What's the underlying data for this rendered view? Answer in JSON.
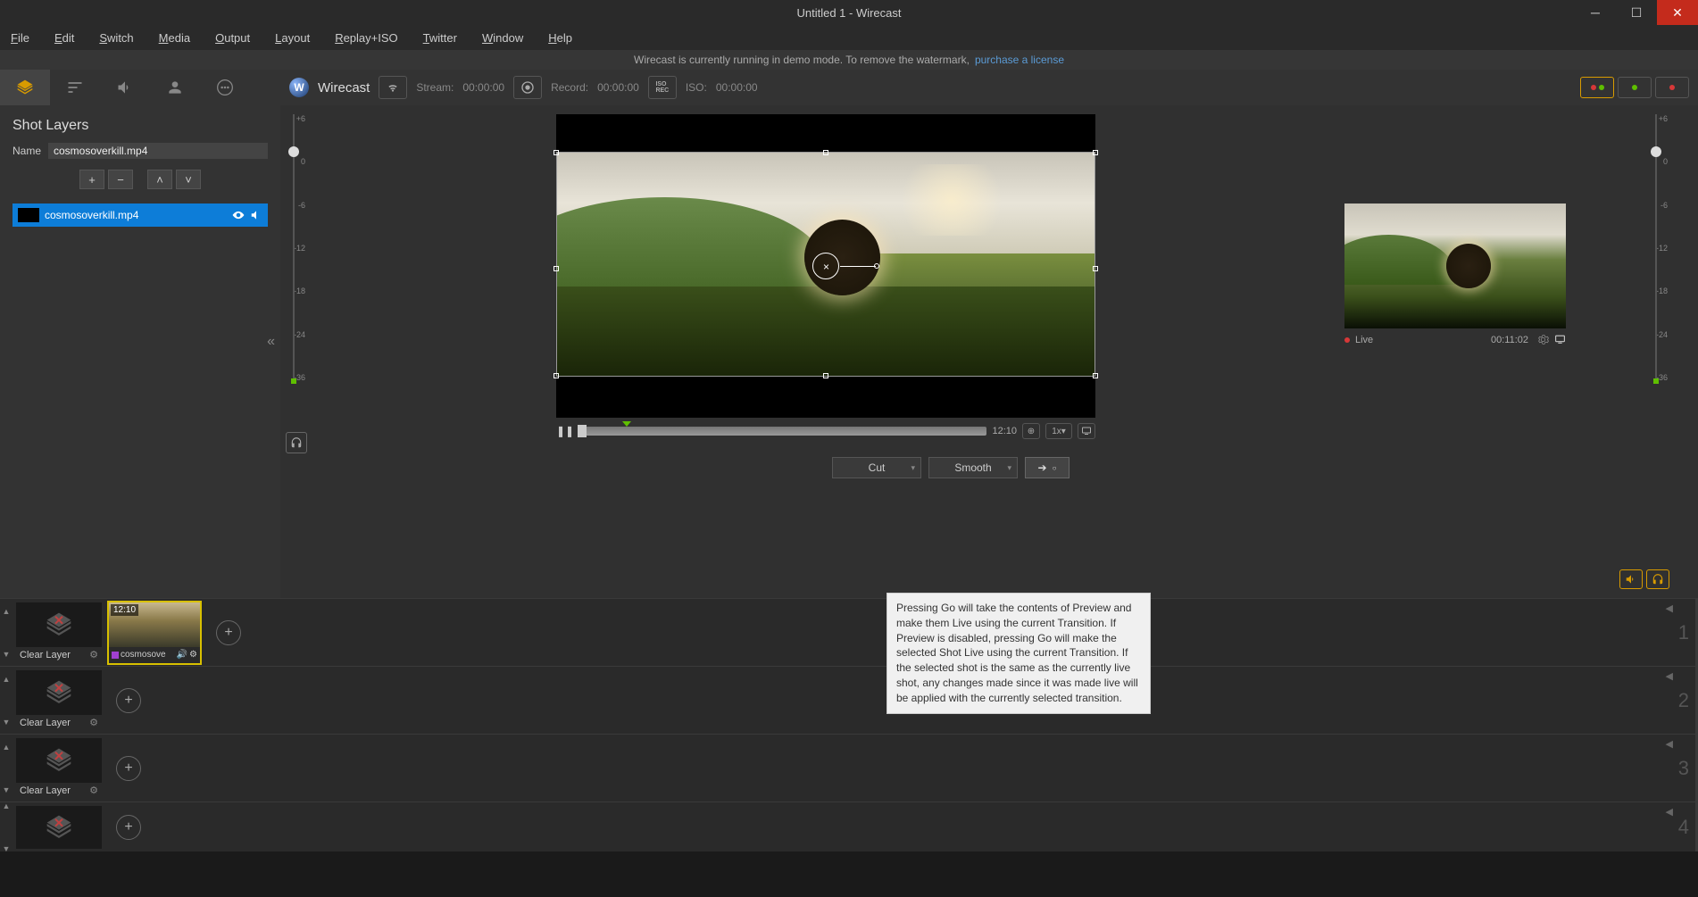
{
  "window": {
    "title": "Untitled 1 - Wirecast"
  },
  "menu": [
    "File",
    "Edit",
    "Switch",
    "Media",
    "Output",
    "Layout",
    "Replay+ISO",
    "Twitter",
    "Window",
    "Help"
  ],
  "demo": {
    "text": "Wirecast is currently running in demo mode. To remove the watermark,",
    "link": "purchase a license"
  },
  "panel": {
    "title": "Shot Layers",
    "name_label": "Name",
    "name_value": "cosmosoverkill.mp4",
    "item": "cosmosoverkill.mp4"
  },
  "toolbar": {
    "brand": "Wirecast",
    "stream_label": "Stream:",
    "stream_time": "00:00:00",
    "record_label": "Record:",
    "record_time": "00:00:00",
    "iso_label": "ISO:",
    "iso_time": "00:00:00"
  },
  "vu_labels": [
    "+6",
    "0",
    "-6",
    "-12",
    "-18",
    "-24",
    "-36"
  ],
  "scrubber": {
    "time": "12:10",
    "speed": "1x"
  },
  "transitions": {
    "cut": "Cut",
    "smooth": "Smooth"
  },
  "live": {
    "label": "Live",
    "time": "00:11:02"
  },
  "tooltip": "Pressing Go will take the contents of Preview and make them Live using the current Transition. If Preview is disabled, pressing Go will make the selected Shot Live using the current Transition. If the selected shot is the same as the currently live shot, any changes made since it was made live will be applied with the currently selected transition.",
  "layers": {
    "clear_label": "Clear Layer",
    "shot_time": "12:10",
    "shot_name": "cosmosove",
    "numbers": [
      "1",
      "2",
      "3",
      "4"
    ]
  }
}
